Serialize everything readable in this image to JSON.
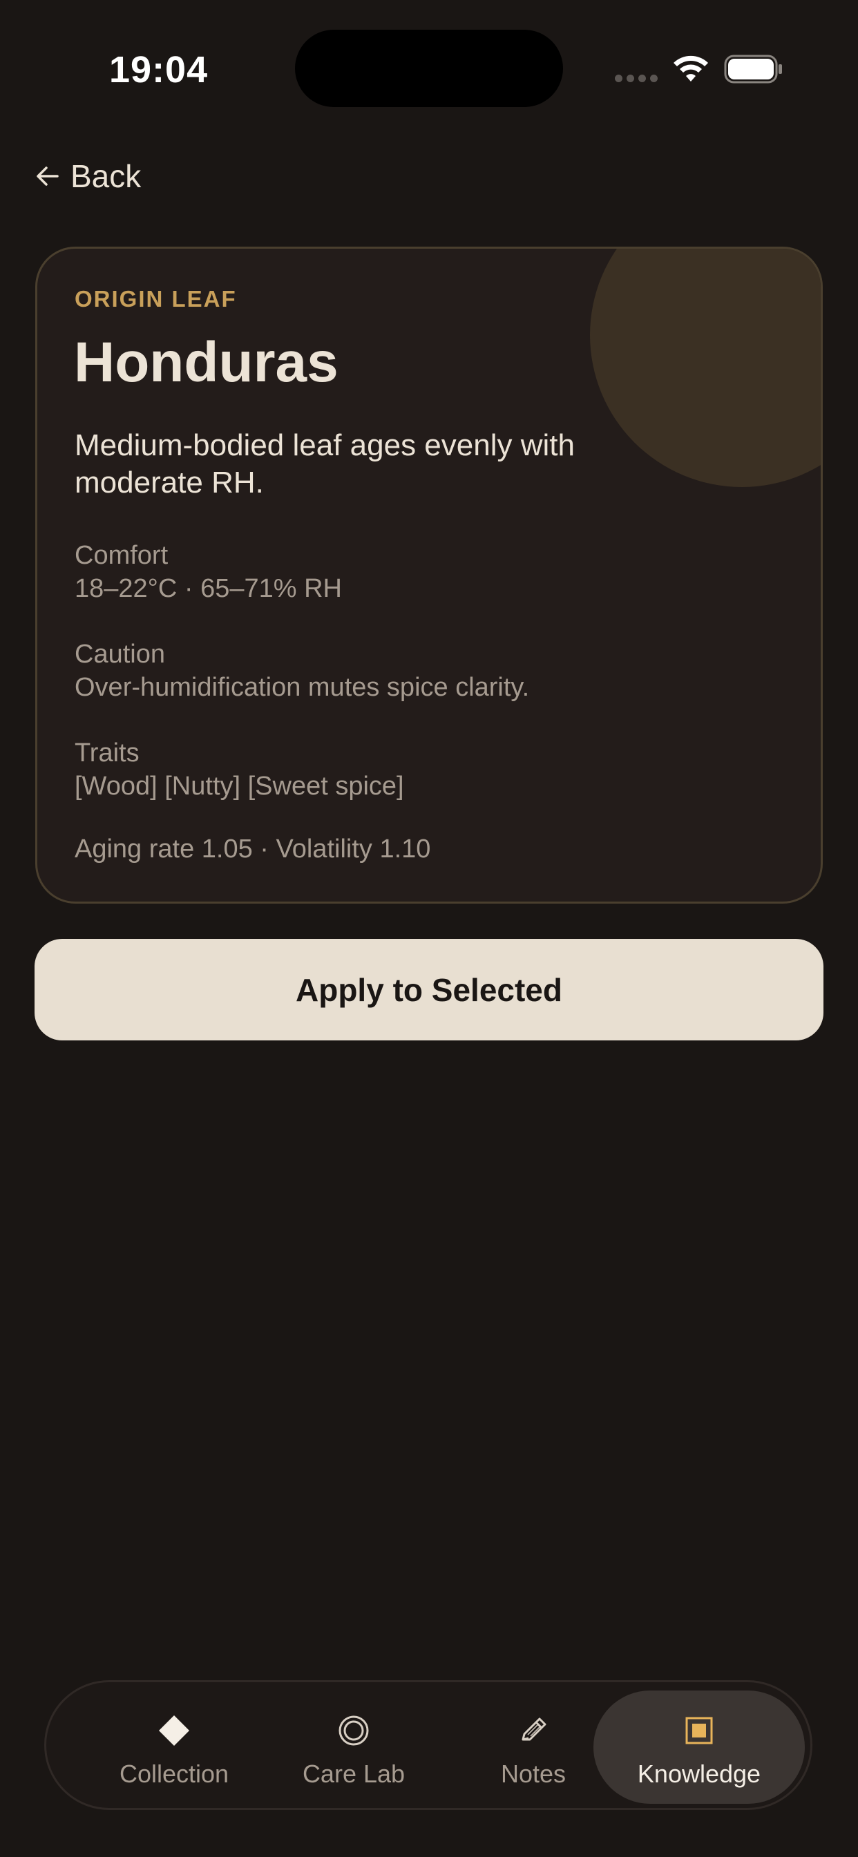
{
  "status_bar": {
    "time": "19:04"
  },
  "nav": {
    "back_label": "Back"
  },
  "card": {
    "eyebrow": "ORIGIN LEAF",
    "title": "Honduras",
    "description": "Medium-bodied leaf ages evenly with moderate RH.",
    "comfort": {
      "label": "Comfort",
      "value": "18–22°C · 65–71% RH"
    },
    "caution": {
      "label": "Caution",
      "value": "Over-humidification mutes spice clarity."
    },
    "traits": {
      "label": "Traits",
      "value": "[Wood] [Nutty] [Sweet spice]"
    },
    "metrics": "Aging rate 1.05 · Volatility 1.10"
  },
  "actions": {
    "apply_label": "Apply to Selected"
  },
  "tabs": [
    {
      "label": "Collection",
      "icon": "diamond-icon"
    },
    {
      "label": "Care Lab",
      "icon": "ring-icon"
    },
    {
      "label": "Notes",
      "icon": "pencil-icon"
    },
    {
      "label": "Knowledge",
      "icon": "square-icon",
      "active": true
    }
  ],
  "colors": {
    "background": "#1a1614",
    "card": "#231c1a",
    "accent": "#c9a05a",
    "button": "#e8dfd1",
    "active_tab": "#3b3532"
  }
}
